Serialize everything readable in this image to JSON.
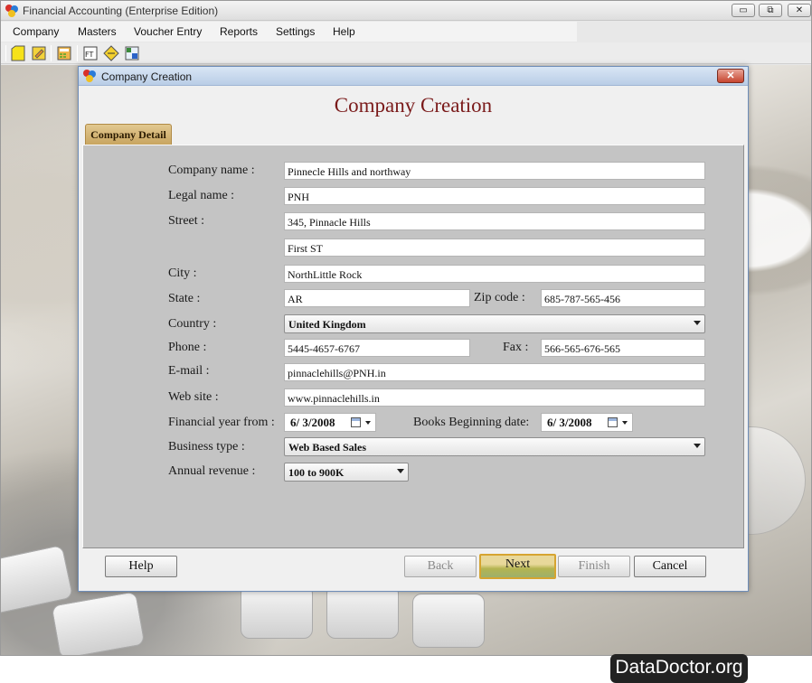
{
  "window": {
    "title": "Financial Accounting (Enterprise Edition)",
    "btn_min": "▭",
    "btn_max": "⧉",
    "btn_close": "✕"
  },
  "menu": [
    "Company",
    "Masters",
    "Voucher Entry",
    "Reports",
    "Settings",
    "Help"
  ],
  "toolbar_icons": [
    "new-company-icon",
    "open-company-icon",
    "calculator-icon",
    "ledger-icon",
    "balance-icon",
    "report-grid-icon"
  ],
  "dialog": {
    "title": "Company Creation",
    "heading": "Company Creation",
    "tab_label": "Company Detail",
    "close_label": "✕"
  },
  "form": {
    "company_name": {
      "label": "Company name :",
      "value": "Pinnecle Hills and northway"
    },
    "legal_name": {
      "label": "Legal name :",
      "value": "PNH"
    },
    "street": {
      "label": "Street :",
      "value1": "345, Pinnacle Hills",
      "value2": "First ST"
    },
    "city": {
      "label": "City :",
      "value": "NorthLittle Rock"
    },
    "state": {
      "label": "State :",
      "value": "AR"
    },
    "zip": {
      "label": "Zip code :",
      "value": "685-787-565-456"
    },
    "country": {
      "label": "Country :",
      "value": "United Kingdom"
    },
    "phone": {
      "label": "Phone :",
      "value": "5445-4657-6767"
    },
    "fax": {
      "label": "Fax :",
      "value": "566-565-676-565"
    },
    "email": {
      "label": "E-mail :",
      "value": "pinnaclehills@PNH.in"
    },
    "website": {
      "label": "Web site :",
      "value": "www.pinnaclehills.in"
    },
    "fy_from": {
      "label": "Financial year from :",
      "value": "6/ 3/2008"
    },
    "books_begin": {
      "label": "Books Beginning date:",
      "value": "6/ 3/2008"
    },
    "business_type": {
      "label": "Business type :",
      "value": "Web Based Sales"
    },
    "annual_revenue": {
      "label": "Annual revenue :",
      "value": "100 to 900K"
    }
  },
  "buttons": {
    "help": "Help",
    "back": "Back",
    "next": "Next",
    "finish": "Finish",
    "cancel": "Cancel"
  },
  "watermark": "DataDoctor.org"
}
